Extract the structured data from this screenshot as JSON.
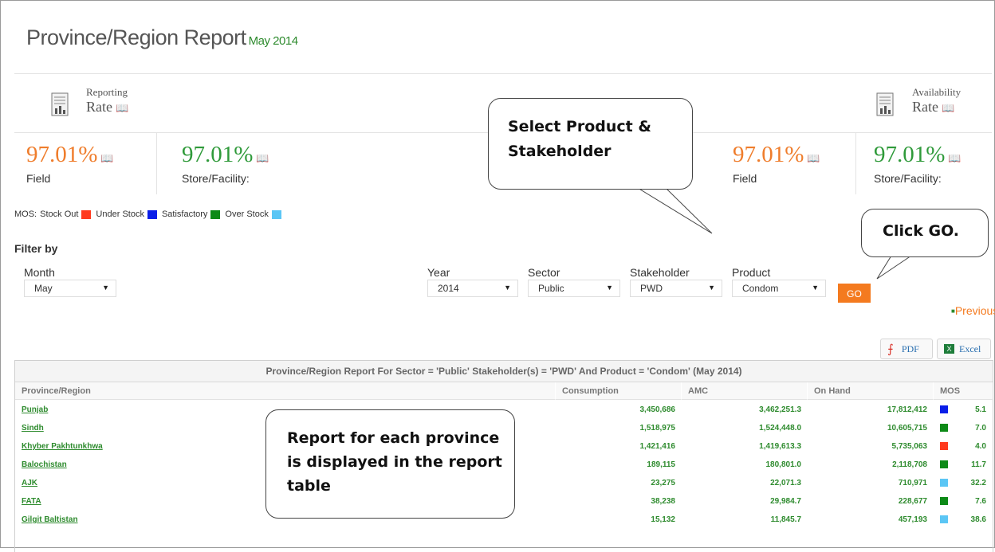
{
  "page": {
    "title": "Province/Region Report",
    "subtitle": "May 2014"
  },
  "kpi": {
    "reporting_small": "Reporting",
    "reporting_big": "Rate",
    "availability_small": "Availability",
    "availability_big": "Rate",
    "left": [
      {
        "value": "97.01%",
        "label": "Field"
      },
      {
        "value": "97.01%",
        "label": "Store/Facility:"
      }
    ],
    "right": [
      {
        "value": "97.01%",
        "label": "Field"
      },
      {
        "value": "97.01%",
        "label": "Store/Facility:"
      }
    ]
  },
  "legend": {
    "prefix": "MOS:",
    "items": [
      {
        "label": "Stock Out",
        "color": "#ff3b1f"
      },
      {
        "label": "Under Stock",
        "color": "#0a1ee8"
      },
      {
        "label": "Satisfactory",
        "color": "#0d8a17"
      },
      {
        "label": "Over Stock",
        "color": "#5bc6f5"
      }
    ]
  },
  "filter": {
    "title": "Filter by",
    "month": {
      "label": "Month",
      "value": "May"
    },
    "year": {
      "label": "Year",
      "value": "2014"
    },
    "sector": {
      "label": "Sector",
      "value": "Public"
    },
    "stakeholder": {
      "label": "Stakeholder",
      "value": "PWD"
    },
    "product": {
      "label": "Product",
      "value": "Condom"
    },
    "go": "GO",
    "previous": "Previous"
  },
  "export": {
    "pdf": "PDF",
    "excel": "Excel"
  },
  "table": {
    "caption": "Province/Region Report For Sector = 'Public' Stakeholder(s) = 'PWD' And Product = 'Condom' (May 2014)",
    "headers": [
      "Province/Region",
      "Consumption",
      "AMC",
      "On Hand",
      "MOS"
    ],
    "rows": [
      {
        "name": "Punjab",
        "consumption": "3,450,686",
        "amc": "3,462,251.3",
        "onhand": "17,812,412",
        "mos": "5.1",
        "color": "#0a1ee8"
      },
      {
        "name": "Sindh",
        "consumption": "1,518,975",
        "amc": "1,524,448.0",
        "onhand": "10,605,715",
        "mos": "7.0",
        "color": "#0d8a17"
      },
      {
        "name": "Khyber Pakhtunkhwa",
        "consumption": "1,421,416",
        "amc": "1,419,613.3",
        "onhand": "5,735,063",
        "mos": "4.0",
        "color": "#ff3b1f"
      },
      {
        "name": "Balochistan",
        "consumption": "189,115",
        "amc": "180,801.0",
        "onhand": "2,118,708",
        "mos": "11.7",
        "color": "#0d8a17"
      },
      {
        "name": "AJK",
        "consumption": "23,275",
        "amc": "22,071.3",
        "onhand": "710,971",
        "mos": "32.2",
        "color": "#5bc6f5"
      },
      {
        "name": "FATA",
        "consumption": "38,238",
        "amc": "29,984.7",
        "onhand": "228,677",
        "mos": "7.6",
        "color": "#0d8a17"
      },
      {
        "name": "Gilgit Baltistan",
        "consumption": "15,132",
        "amc": "11,845.7",
        "onhand": "457,193",
        "mos": "38.6",
        "color": "#5bc6f5"
      }
    ]
  },
  "callouts": {
    "select": "Select Product & Stakeholder",
    "go": "Click GO.",
    "report": "Report for each province is displayed in the report table"
  }
}
